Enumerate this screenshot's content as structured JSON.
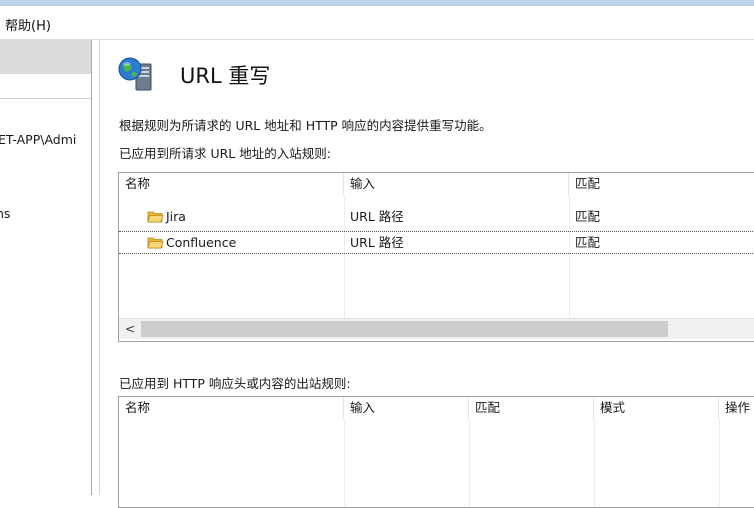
{
  "menu": {
    "help_label": "帮助(H)"
  },
  "connections": {
    "server_node": "ET-APP\\Admi",
    "apps_node": "ns"
  },
  "feature": {
    "title": "URL 重写",
    "description": "根据规则为所请求的 URL 地址和 HTTP 响应的内容提供重写功能。",
    "icon": "globe-server-icon"
  },
  "inbound": {
    "label": "已应用到所请求 URL 地址的入站规则:",
    "columns": [
      "名称",
      "输入",
      "匹配"
    ],
    "rows": [
      {
        "name": "Jira",
        "input": "URL 路径",
        "match": "匹配"
      },
      {
        "name": "Confluence",
        "input": "URL 路径",
        "match": "匹配"
      }
    ],
    "scroll_left_glyph": "<"
  },
  "outbound": {
    "label": "已应用到 HTTP 响应头或内容的出站规则:",
    "columns": [
      "名称",
      "输入",
      "匹配",
      "模式",
      "操作"
    ]
  },
  "colors": {
    "selection_border": "#555555",
    "folder": "#f2c44f",
    "header_gray": "#dcdcdc"
  }
}
